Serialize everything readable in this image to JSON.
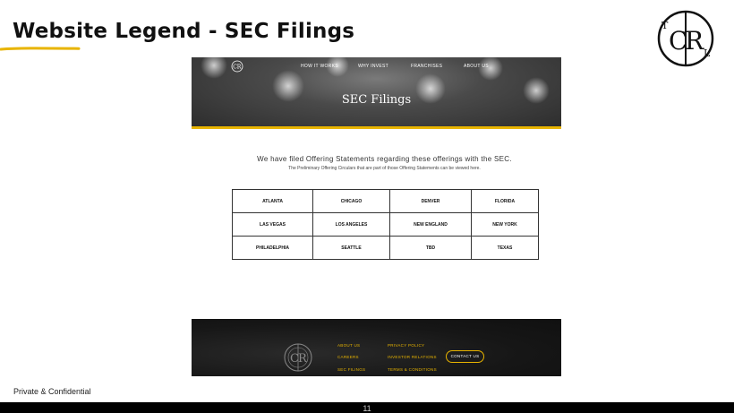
{
  "slide": {
    "title": "Website Legend - SEC Filings",
    "confidential": "Private & Confidential",
    "page_number": "11",
    "accent_color": "#e8b400"
  },
  "logo": {
    "letters": [
      "T",
      "C",
      "R",
      "L"
    ],
    "icon": "tcrl-monogram-icon"
  },
  "website": {
    "nav": {
      "logo_text": "CR",
      "items": [
        "HOW IT WORKS",
        "WHY INVEST",
        "FRANCHISES",
        "ABOUT US"
      ]
    },
    "hero_title": "SEC Filings",
    "intro": {
      "main": "We have filed Offering Statements regarding these offerings with the SEC.",
      "sub": "The Preliminary Offering Circulars that are part of those Offering Statements can be viewed here."
    },
    "filings": [
      [
        "ATLANTA",
        "CHICAGO",
        "DENVER",
        "FLORIDA"
      ],
      [
        "LAS VEGAS",
        "LOS ANGELES",
        "NEW ENGLAND",
        "NEW YORK"
      ],
      [
        "PHILADELPHIA",
        "SEATTLE",
        "TBD",
        "TEXAS"
      ]
    ],
    "footer": {
      "col1": [
        "ABOUT US",
        "CAREERS",
        "SEC FILINGS"
      ],
      "col2": [
        "PRIVACY POLICY",
        "INVESTOR RELATIONS",
        "TERMS & CONDITIONS"
      ],
      "contact_button": "CONTACT US"
    }
  }
}
